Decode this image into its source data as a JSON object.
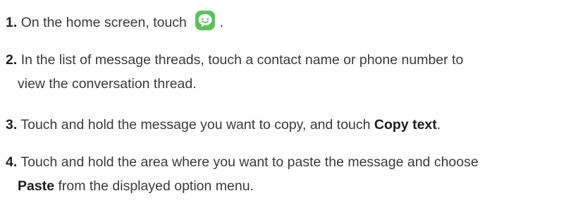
{
  "steps": [
    {
      "number": "1.",
      "text_before": "On the home screen, touch",
      "icon": "messaging-icon",
      "text_after": "."
    },
    {
      "number": "2.",
      "line1": "In the list of message threads, touch a contact name or phone number to",
      "line2": "view the conversation thread."
    },
    {
      "number": "3.",
      "text_before": "Touch and hold the message you want to copy, and touch",
      "bold": "Copy text",
      "text_after": "."
    },
    {
      "number": "4.",
      "line1": "Touch and hold the area where you want to paste the message and choose",
      "bold": "Paste",
      "line2_after": "from the displayed option menu."
    }
  ],
  "colors": {
    "text": "#3a3a3a",
    "icon_bg": "#5cc15c"
  }
}
